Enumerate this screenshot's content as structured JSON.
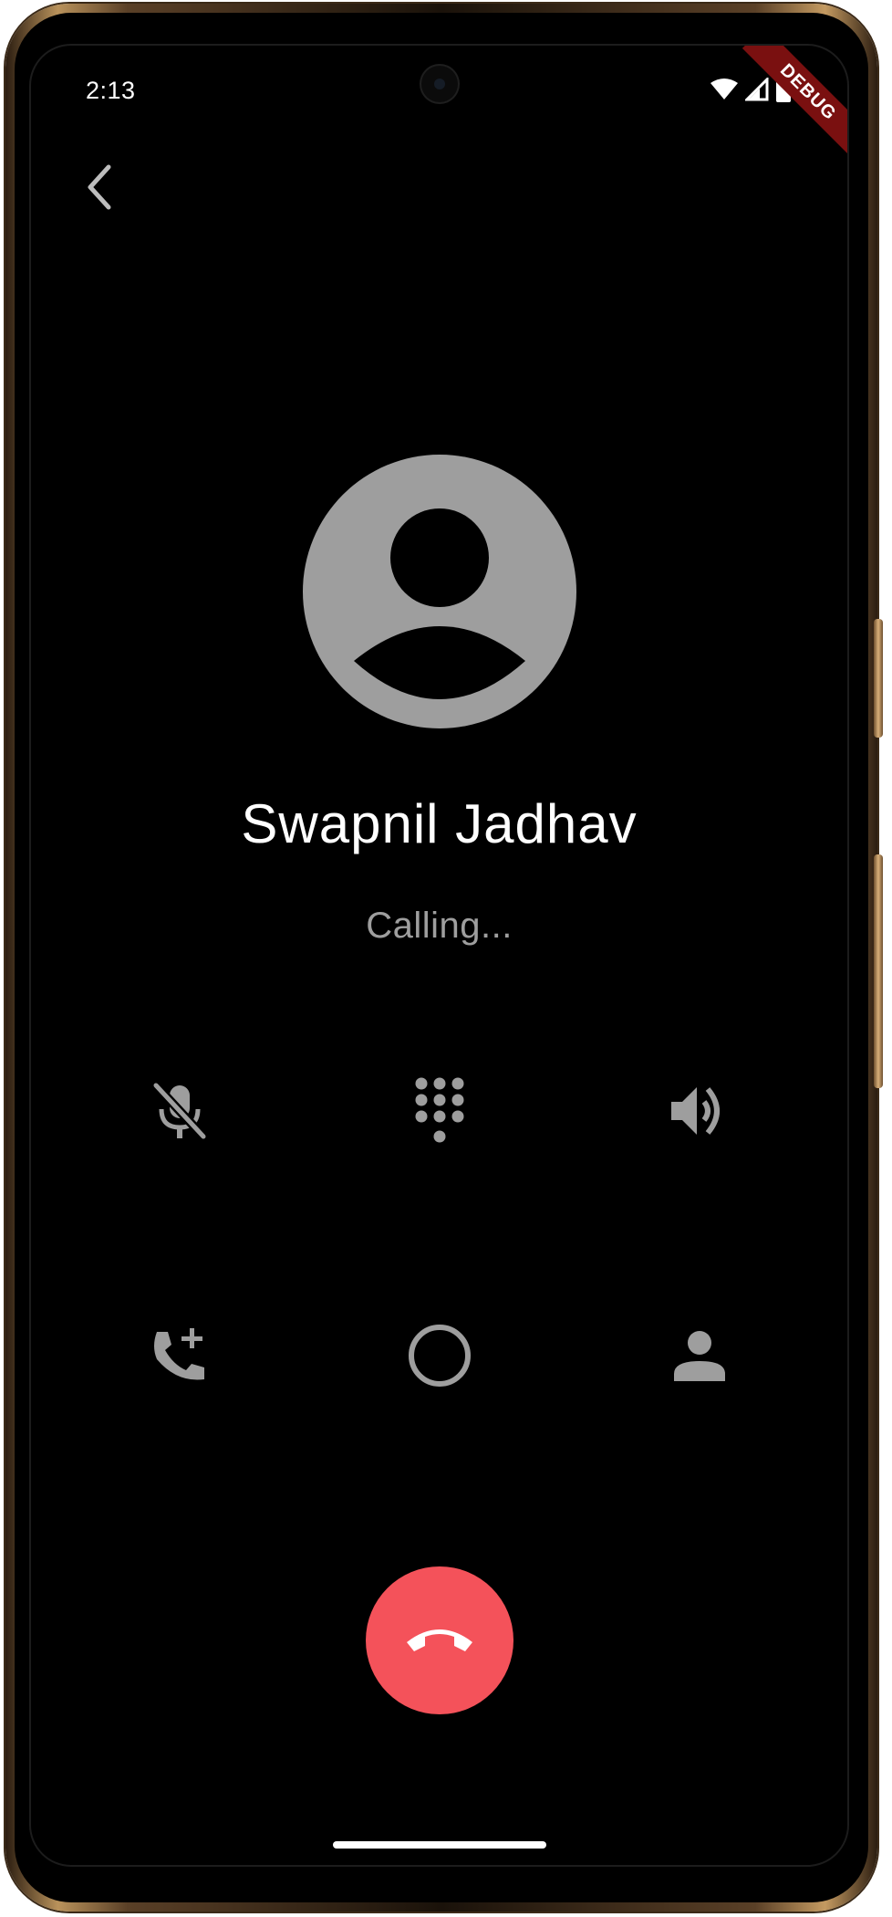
{
  "status_bar": {
    "time": "2:13",
    "icons": [
      "wifi-icon",
      "cellular-signal-icon",
      "battery-icon"
    ]
  },
  "debug_banner": {
    "label": "DEBUG",
    "color": "#7a1010"
  },
  "header": {
    "back_icon": "chevron-left-icon"
  },
  "caller": {
    "name": "Swapnil Jadhav",
    "status": "Calling...",
    "avatar_icon": "account-circle-icon"
  },
  "controls": [
    {
      "id": "mute",
      "icon": "mic-off-icon"
    },
    {
      "id": "keypad",
      "icon": "dialpad-icon"
    },
    {
      "id": "speaker",
      "icon": "volume-up-icon"
    },
    {
      "id": "add-call",
      "icon": "add-call-icon"
    },
    {
      "id": "hold",
      "icon": "circle-outline-icon"
    },
    {
      "id": "contacts",
      "icon": "person-icon"
    }
  ],
  "end_call": {
    "icon": "call-end-icon",
    "color": "#f4525a"
  },
  "colors": {
    "background": "#000000",
    "icon_gray": "#9e9e9e",
    "text_primary": "#ffffff",
    "text_secondary": "#9e9e9e",
    "end_call": "#f4525a"
  }
}
